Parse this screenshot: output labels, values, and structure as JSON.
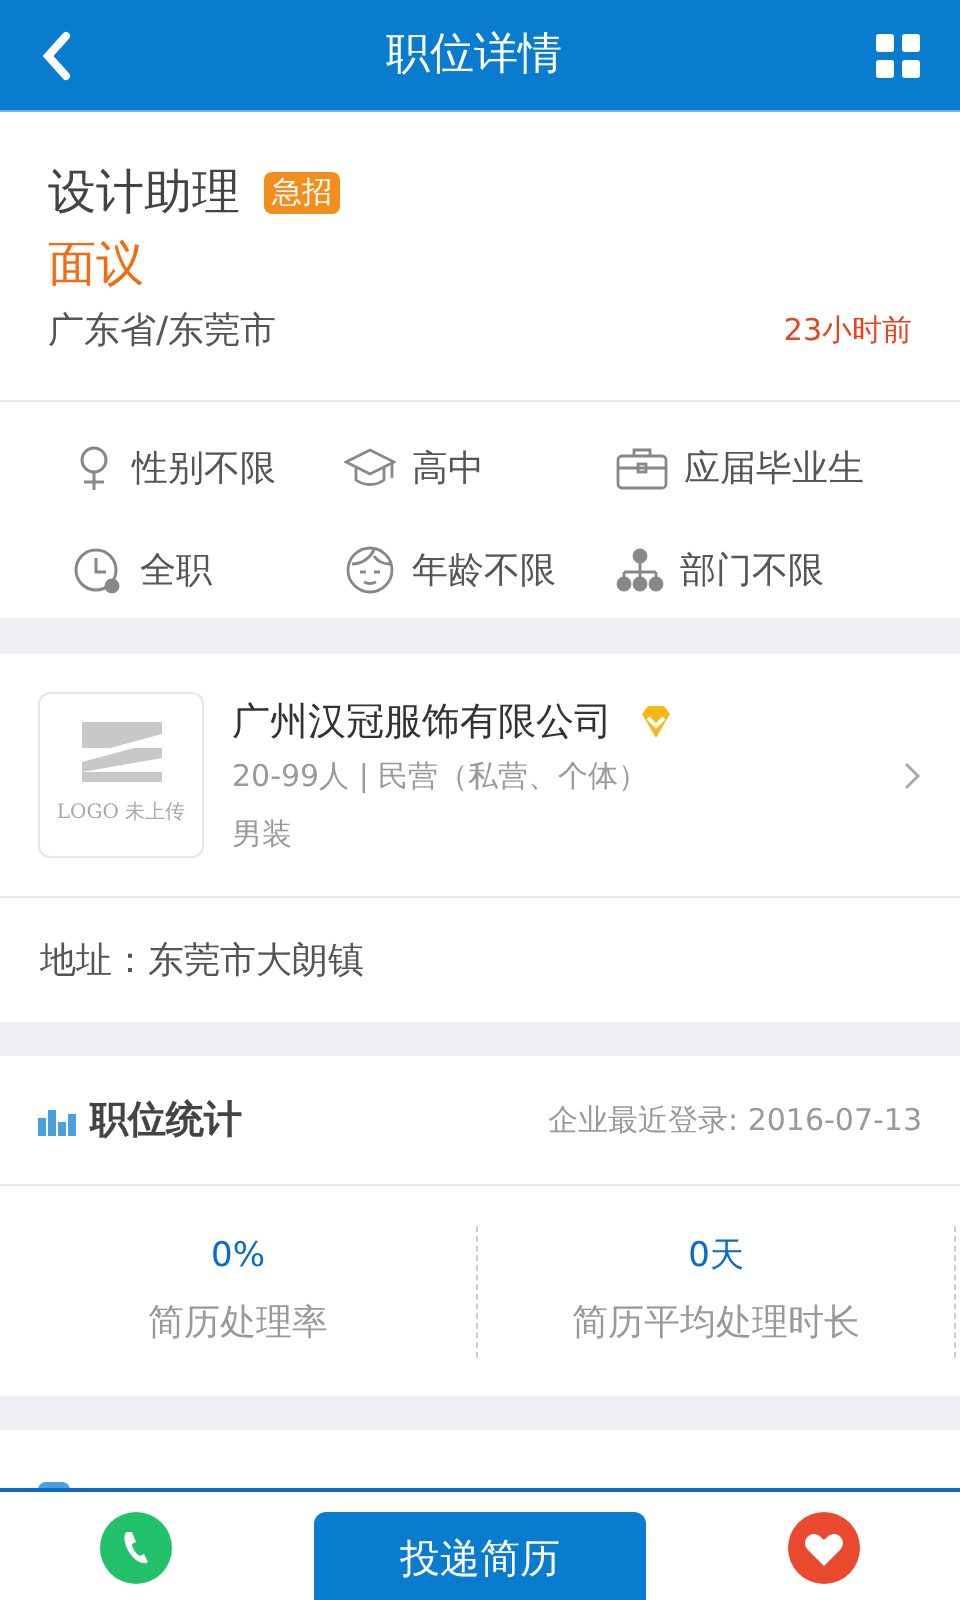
{
  "header": {
    "title": "职位详情"
  },
  "job": {
    "title": "设计助理",
    "badge": "急招",
    "salary": "面议",
    "location": "广东省/东莞市",
    "posted": "23小时前"
  },
  "requirements": [
    {
      "kind": "gender",
      "label": "性别不限"
    },
    {
      "kind": "education",
      "label": "高中"
    },
    {
      "kind": "experience",
      "label": "应届毕业生"
    },
    {
      "kind": "worktype",
      "label": "全职"
    },
    {
      "kind": "age",
      "label": "年龄不限"
    },
    {
      "kind": "department",
      "label": "部门不限"
    }
  ],
  "company": {
    "logo_text": "LOGO 未上传",
    "name": "广州汉冠服饰有限公司",
    "verified": true,
    "info": "20-99人 | 民营（私营、个体）",
    "industry": "男装"
  },
  "address": "地址：东莞市大朗镇",
  "stats": {
    "title": "职位统计",
    "last_login": "企业最近登录: 2016-07-13",
    "items": [
      {
        "value": "0%",
        "label": "简历处理率"
      },
      {
        "value": "0天",
        "label": "简历平均处理时长"
      }
    ]
  },
  "bottom_bar": {
    "apply_button": "投递简历"
  }
}
